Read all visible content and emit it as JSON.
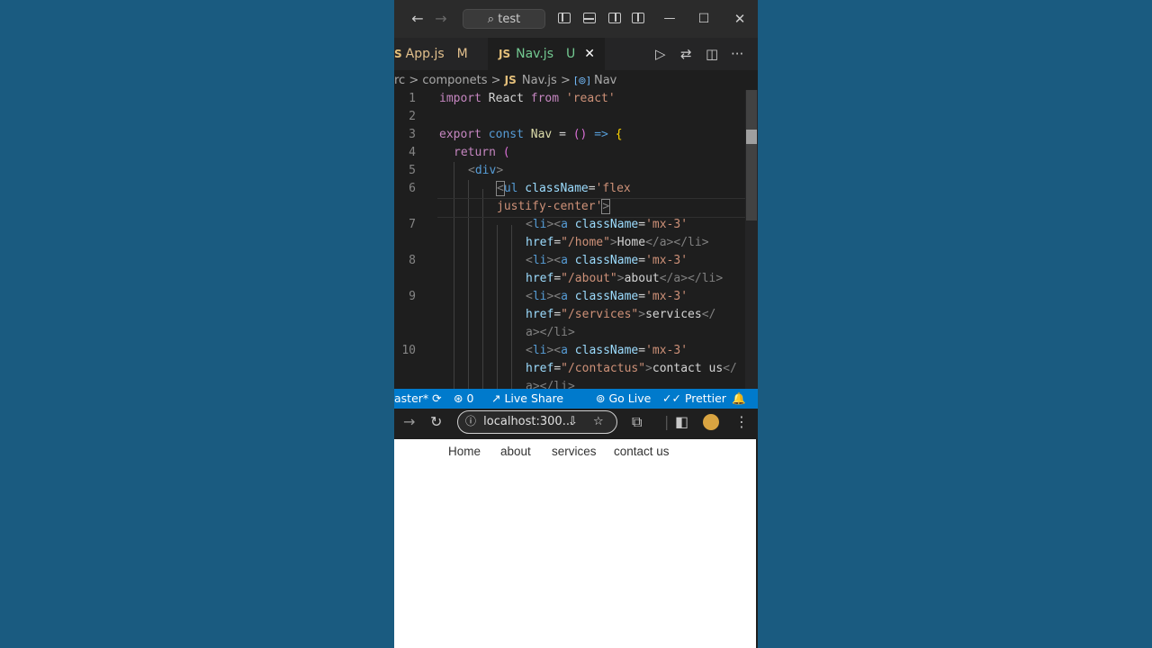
{
  "titlebar": {
    "back": "←",
    "forward": "→",
    "search_text": "test",
    "minimize": "—",
    "maximize": "☐",
    "close": "✕"
  },
  "tabs": [
    {
      "badge": "S",
      "name": "App.js",
      "status": "M",
      "name_color": "#e2c08d"
    },
    {
      "badge": "JS",
      "name": "Nav.js",
      "status": "U",
      "name_color": "#73c991",
      "close": "✕"
    }
  ],
  "tab_actions": {
    "run": "▷",
    "compare": "⇄",
    "split": "◫",
    "more": "···"
  },
  "breadcrumb": {
    "parts": [
      "rc",
      "componets",
      "Nav.js",
      "Nav"
    ],
    "sep": ">",
    "js": "JS",
    "symbol": "[⊚]"
  },
  "editor": {
    "line_numbers": [
      "1",
      "2",
      "3",
      "4",
      "5",
      "6",
      "7",
      "8",
      "9",
      "10"
    ],
    "code": {
      "l1_import": "import",
      "l1_react": " React ",
      "l1_from": "from",
      "l1_str": " 'react'",
      "l3_export": "export",
      "l3_const": " const",
      "l3_nav": " Nav",
      "l3_eq": " = ",
      "l3_paren": "()",
      "l3_arrow": " => ",
      "l3_brace": "{",
      "l4_return": "return",
      "l4_paren": " (",
      "l5_open": "<",
      "l5_div": "div",
      "l5_close": ">",
      "l6_open": "<",
      "l6_ul": "ul",
      "l6_attr": " className",
      "l6_eq": "=",
      "l6_str": "'flex",
      "l6b_str": "justify-center'",
      "l6b_close": ">",
      "li_open": "<",
      "li_li": "li",
      "li_gt": "><",
      "li_a": "a",
      "li_attr": " className",
      "li_eq": "=",
      "li_str": "'mx-3'",
      "href": "href",
      "l7_href_val": "\"/home\"",
      "l7_text": "Home",
      "l8_href_val": "\"/about\"",
      "l8_text": "about",
      "l9_href_val": "\"/services\"",
      "l9_text": "services",
      "l10_href_val": "\"/contactus\"",
      "l10_text": "contact us",
      "close_a_li": "</a></li>",
      "close_a_partial": "</",
      "a_close_li": "a></li>"
    }
  },
  "statusbar": {
    "branch": "aster*",
    "ports": "0",
    "live_share": "Live Share",
    "go_live": "Go Live",
    "prettier": "Prettier"
  },
  "browser": {
    "url": "localhost:300..."
  },
  "webpage": {
    "nav": [
      "Home",
      "about",
      "services",
      "contact us"
    ]
  }
}
